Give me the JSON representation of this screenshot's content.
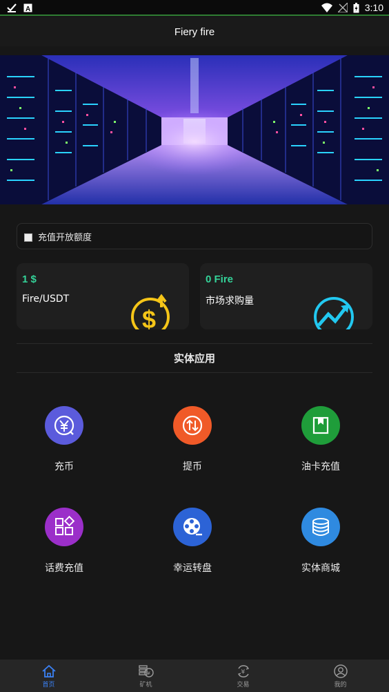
{
  "statusbar": {
    "time": "3:10",
    "left_icons": [
      "check-download-icon",
      "font-a-icon"
    ],
    "right_icons": [
      "wifi-icon",
      "no-sim-icon",
      "battery-icon"
    ]
  },
  "header": {
    "title": "Fiery fire"
  },
  "notice": {
    "text": "充值开放额度"
  },
  "stats": [
    {
      "value": "1 $",
      "label": "Fire/USDT",
      "icon": "dollar-coin-icon"
    },
    {
      "value": "0 Fire",
      "label": "市场求购量",
      "icon": "trend-chart-icon"
    }
  ],
  "section": {
    "title": "实体应用"
  },
  "apps": [
    {
      "label": "充币",
      "icon": "yuan-recharge-icon",
      "color": "#5b5bdc"
    },
    {
      "label": "提币",
      "icon": "transfer-icon",
      "color": "#f05a28"
    },
    {
      "label": "油卡充值",
      "icon": "fuel-card-icon",
      "color": "#1f9d3a"
    },
    {
      "label": "话费充值",
      "icon": "apps-grid-icon",
      "color": "#9b2fc9"
    },
    {
      "label": "幸运转盘",
      "icon": "film-reel-icon",
      "color": "#2c63d6"
    },
    {
      "label": "实体商城",
      "icon": "database-icon",
      "color": "#2f8ae0"
    }
  ],
  "tabs": [
    {
      "label": "首页",
      "icon": "home-icon",
      "active": true
    },
    {
      "label": "矿机",
      "icon": "coins-icon",
      "active": false
    },
    {
      "label": "交易",
      "icon": "yuan-exchange-icon",
      "active": false
    },
    {
      "label": "我的",
      "icon": "user-icon",
      "active": false
    }
  ],
  "colors": {
    "accent": "#3b82f6",
    "value_green": "#34d399",
    "background": "#171717"
  }
}
